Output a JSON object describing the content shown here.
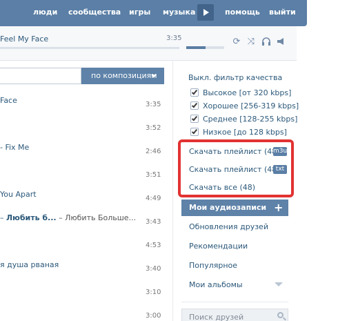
{
  "nav": {
    "items": [
      "люди",
      "сообщества",
      "игры",
      "музыка",
      "помощь",
      "выйти"
    ]
  },
  "player": {
    "title": "Feel My Face",
    "time": "3:35"
  },
  "search": {
    "filter_label": "по композициям"
  },
  "tracks": [
    {
      "name": "Face",
      "bold": "",
      "sub": "",
      "duration": "3:35"
    },
    {
      "name": "",
      "bold": "",
      "sub": "",
      "duration": "3:52"
    },
    {
      "name": "- Fix Me",
      "bold": "",
      "sub": "",
      "duration": "2:46"
    },
    {
      "name": "",
      "bold": "",
      "sub": "",
      "duration": "3:51"
    },
    {
      "name": "You Apart",
      "bold": "",
      "sub": "",
      "duration": "4:49"
    },
    {
      "name": "– ",
      "bold": "Любить б...",
      "sub": " – Любить Больше...",
      "duration": "3:43"
    },
    {
      "name": "",
      "bold": "",
      "sub": "",
      "duration": "4:53"
    },
    {
      "name": "я душа рваная",
      "bold": "",
      "sub": "",
      "duration": "3:40"
    },
    {
      "name": "",
      "bold": "",
      "sub": "",
      "duration": "3:10"
    },
    {
      "name": "",
      "bold": "",
      "sub": "",
      "duration": "3:00"
    }
  ],
  "quality": {
    "title": "Выкл. фильтр качества",
    "options": [
      {
        "label": "Высокое [от 320 kbps]",
        "checked": true
      },
      {
        "label": "Хорошее [256-319 kbps]",
        "checked": true
      },
      {
        "label": "Среднее [128-255 kbps]",
        "checked": true
      },
      {
        "label": "Низкое [до 128 kbps]",
        "checked": true
      }
    ]
  },
  "downloads": [
    {
      "label": "Скачать плейлист (48)",
      "badge": "m3u"
    },
    {
      "label": "Скачать плейлист (48)",
      "badge": "txt"
    },
    {
      "label": "Скачать все (48)",
      "badge": ""
    }
  ],
  "menu": {
    "active": "Мои аудиозаписи",
    "items": [
      "Обновления друзей",
      "Рекомендации",
      "Популярное",
      "Мои альбомы"
    ]
  },
  "friends_search": {
    "placeholder": "Поиск друзей"
  },
  "colors": {
    "header": "#5b7fa6",
    "accent": "#5e82a8",
    "link": "#2b587a",
    "highlight": "#e23232"
  },
  "icons": [
    "play-icon",
    "repeat-icon",
    "shuffle-icon",
    "headphones-icon",
    "broadcast-icon",
    "plus-icon",
    "chevron-down-icon",
    "search-icon"
  ]
}
